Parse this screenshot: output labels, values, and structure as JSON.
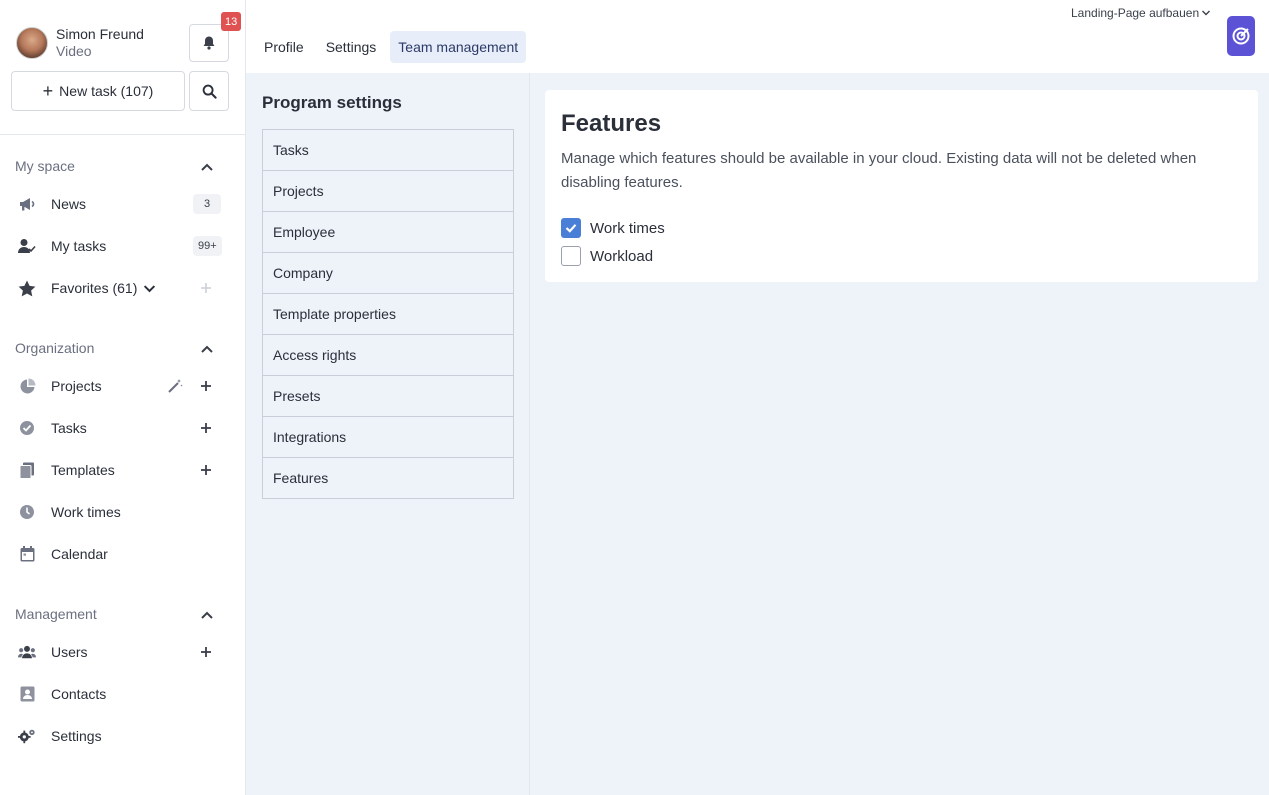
{
  "user": {
    "name": "Simon Freund",
    "subtitle": "Video"
  },
  "notifications": {
    "count": "13"
  },
  "new_task": {
    "label": "New task (107)"
  },
  "sections": {
    "my_space": {
      "title": "My space",
      "items": [
        {
          "label": "News",
          "count": "3",
          "icon": "megaphone-icon"
        },
        {
          "label": "My tasks",
          "count": "99+",
          "icon": "user-check-icon"
        },
        {
          "label": "Favorites (61)",
          "icon": "star-icon"
        }
      ]
    },
    "organization": {
      "title": "Organization",
      "items": [
        {
          "label": "Projects",
          "icon": "pie-chart-icon"
        },
        {
          "label": "Tasks",
          "icon": "check-circle-icon"
        },
        {
          "label": "Templates",
          "icon": "copy-icon"
        },
        {
          "label": "Work times",
          "icon": "clock-icon"
        },
        {
          "label": "Calendar",
          "icon": "calendar-icon"
        }
      ]
    },
    "management": {
      "title": "Management",
      "items": [
        {
          "label": "Users",
          "icon": "users-icon"
        },
        {
          "label": "Contacts",
          "icon": "contact-card-icon"
        },
        {
          "label": "Settings",
          "icon": "gears-icon"
        }
      ]
    }
  },
  "header": {
    "tabs": [
      {
        "label": "Profile",
        "active": false
      },
      {
        "label": "Settings",
        "active": false
      },
      {
        "label": "Team management",
        "active": true
      }
    ],
    "project": "Landing-Page aufbauen"
  },
  "program_settings": {
    "title": "Program settings",
    "items": [
      "Tasks",
      "Projects",
      "Employee",
      "Company",
      "Template properties",
      "Access rights",
      "Presets",
      "Integrations",
      "Features"
    ]
  },
  "features": {
    "title": "Features",
    "description": "Manage which features should be available in your cloud. Existing data will not be deleted when disabling features.",
    "options": [
      {
        "label": "Work times",
        "checked": true
      },
      {
        "label": "Workload",
        "checked": false
      }
    ]
  },
  "colors": {
    "accent": "#4a7fd8",
    "brand": "#5b52d6",
    "badge": "#e05252"
  }
}
